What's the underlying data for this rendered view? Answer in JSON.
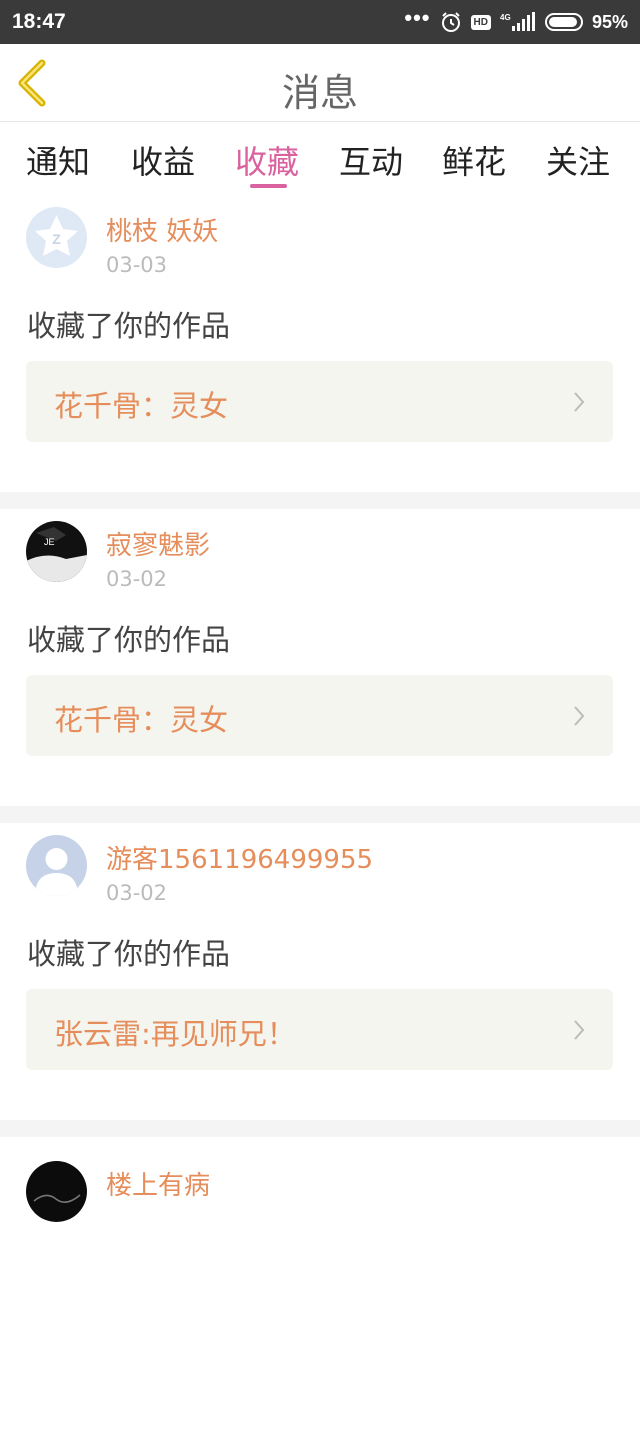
{
  "status_bar": {
    "time": "18:47",
    "dots": "•••",
    "network": "4G",
    "hd": "HD",
    "battery": "95%",
    "battery_level": 0.95
  },
  "nav": {
    "title": "消息",
    "back_icon": "back-chevron-icon"
  },
  "tabs": [
    {
      "label": "通知",
      "active": false
    },
    {
      "label": "收益",
      "active": false
    },
    {
      "label": "收藏",
      "active": true
    },
    {
      "label": "互动",
      "active": false
    },
    {
      "label": "鲜花",
      "active": false
    },
    {
      "label": "关注",
      "active": false
    }
  ],
  "accent_color": "#d9629f",
  "name_color": "#e58d5b",
  "messages": [
    {
      "user": "桃枝 妖妖",
      "date": "03-03",
      "action": "收藏了你的作品",
      "work": "花千骨：灵女"
    },
    {
      "user": "寂寥魅影",
      "date": "03-02",
      "action": "收藏了你的作品",
      "work": "花千骨：灵女"
    },
    {
      "user": "游客1561196499955",
      "date": "03-02",
      "action": "收藏了你的作品",
      "work": "张云雷:再见师兄！"
    },
    {
      "user": "楼上有病"
    }
  ]
}
